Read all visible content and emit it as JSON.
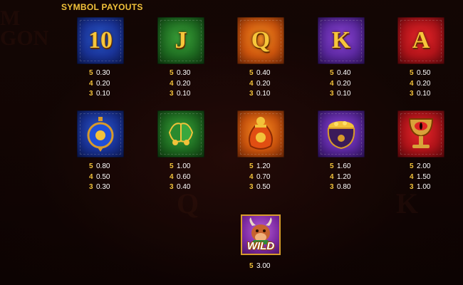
{
  "title": "SYMBOL PAYOUTS",
  "symbols": [
    {
      "label": "10",
      "icon": "ten-card-icon",
      "color": "blue",
      "pays": [
        {
          "n": "5",
          "v": "0.30"
        },
        {
          "n": "4",
          "v": "0.20"
        },
        {
          "n": "3",
          "v": "0.10"
        }
      ]
    },
    {
      "label": "J",
      "icon": "jack-card-icon",
      "color": "green",
      "pays": [
        {
          "n": "5",
          "v": "0.30"
        },
        {
          "n": "4",
          "v": "0.20"
        },
        {
          "n": "3",
          "v": "0.10"
        }
      ]
    },
    {
      "label": "Q",
      "icon": "queen-card-icon",
      "color": "orange",
      "pays": [
        {
          "n": "5",
          "v": "0.40"
        },
        {
          "n": "4",
          "v": "0.20"
        },
        {
          "n": "3",
          "v": "0.10"
        }
      ]
    },
    {
      "label": "K",
      "icon": "king-card-icon",
      "color": "purple",
      "pays": [
        {
          "n": "5",
          "v": "0.40"
        },
        {
          "n": "4",
          "v": "0.20"
        },
        {
          "n": "3",
          "v": "0.10"
        }
      ]
    },
    {
      "label": "A",
      "icon": "ace-card-icon",
      "color": "red",
      "pays": [
        {
          "n": "5",
          "v": "0.50"
        },
        {
          "n": "4",
          "v": "0.20"
        },
        {
          "n": "3",
          "v": "0.10"
        }
      ]
    },
    {
      "icon": "lantern-icon",
      "color": "blue",
      "pays": [
        {
          "n": "5",
          "v": "0.80"
        },
        {
          "n": "4",
          "v": "0.50"
        },
        {
          "n": "3",
          "v": "0.30"
        }
      ]
    },
    {
      "icon": "bells-icon",
      "color": "green",
      "pays": [
        {
          "n": "5",
          "v": "1.00"
        },
        {
          "n": "4",
          "v": "0.60"
        },
        {
          "n": "3",
          "v": "0.40"
        }
      ]
    },
    {
      "icon": "coin-bag-icon",
      "color": "orange",
      "pays": [
        {
          "n": "5",
          "v": "1.20"
        },
        {
          "n": "4",
          "v": "0.70"
        },
        {
          "n": "3",
          "v": "0.50"
        }
      ]
    },
    {
      "icon": "treasure-pot-icon",
      "color": "purple",
      "pays": [
        {
          "n": "5",
          "v": "1.60"
        },
        {
          "n": "4",
          "v": "1.20"
        },
        {
          "n": "3",
          "v": "0.80"
        }
      ]
    },
    {
      "icon": "dragon-eye-goblet-icon",
      "color": "red",
      "pays": [
        {
          "n": "5",
          "v": "2.00"
        },
        {
          "n": "4",
          "v": "1.50"
        },
        {
          "n": "3",
          "v": "1.00"
        }
      ]
    }
  ],
  "wild": {
    "label": "WILD",
    "icon": "ox-wild-icon",
    "pays": [
      {
        "n": "5",
        "v": "3.00"
      }
    ]
  }
}
